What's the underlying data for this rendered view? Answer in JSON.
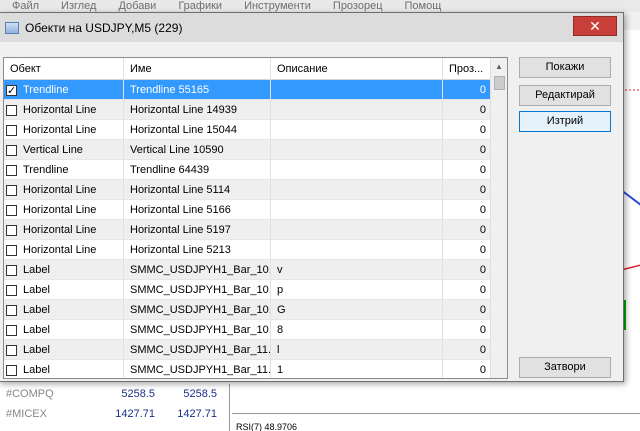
{
  "menu": [
    "Файл",
    "Изглед",
    "Добави",
    "Графики",
    "Инструменти",
    "Прозорец",
    "Помощ"
  ],
  "dialog": {
    "title": "Обекти на USDJPY,M5 (229)",
    "close_glyph": "✕",
    "columns": [
      "Обект",
      "Име",
      "Описание",
      "Проз..."
    ],
    "rows": [
      {
        "checked": true,
        "type": "Trendline",
        "name": "Trendline 55165",
        "desc": "",
        "window": "0"
      },
      {
        "checked": false,
        "type": "Horizontal Line",
        "name": "Horizontal Line 14939",
        "desc": "",
        "window": "0"
      },
      {
        "checked": false,
        "type": "Horizontal Line",
        "name": "Horizontal Line 15044",
        "desc": "",
        "window": "0"
      },
      {
        "checked": false,
        "type": "Vertical Line",
        "name": "Vertical Line 10590",
        "desc": "",
        "window": "0"
      },
      {
        "checked": false,
        "type": "Trendline",
        "name": "Trendline 64439",
        "desc": "",
        "window": "0"
      },
      {
        "checked": false,
        "type": "Horizontal Line",
        "name": "Horizontal Line 5114",
        "desc": "",
        "window": "0"
      },
      {
        "checked": false,
        "type": "Horizontal Line",
        "name": "Horizontal Line 5166",
        "desc": "",
        "window": "0"
      },
      {
        "checked": false,
        "type": "Horizontal Line",
        "name": "Horizontal Line 5197",
        "desc": "",
        "window": "0"
      },
      {
        "checked": false,
        "type": "Horizontal Line",
        "name": "Horizontal Line 5213",
        "desc": "",
        "window": "0"
      },
      {
        "checked": false,
        "type": "Label",
        "name": "SMMC_USDJPYH1_Bar_10...",
        "desc": "v",
        "window": "0"
      },
      {
        "checked": false,
        "type": "Label",
        "name": "SMMC_USDJPYH1_Bar_10...",
        "desc": "p",
        "window": "0"
      },
      {
        "checked": false,
        "type": "Label",
        "name": "SMMC_USDJPYH1_Bar_10...",
        "desc": "G",
        "window": "0"
      },
      {
        "checked": false,
        "type": "Label",
        "name": "SMMC_USDJPYH1_Bar_10...",
        "desc": "8",
        "window": "0"
      },
      {
        "checked": false,
        "type": "Label",
        "name": "SMMC_USDJPYH1_Bar_11...",
        "desc": "l",
        "window": "0"
      },
      {
        "checked": false,
        "type": "Label",
        "name": "SMMC_USDJPYH1_Bar_11...",
        "desc": "1",
        "window": "0"
      }
    ],
    "buttons": {
      "show": "Покажи",
      "edit": "Редактирай",
      "delete": "Изтрий",
      "close": "Затвори"
    }
  },
  "watch": [
    {
      "symbol": "#COMPQ",
      "bid": "5258.5",
      "ask": "5258.5"
    },
    {
      "symbol": "#MICEX",
      "bid": "1427.71",
      "ask": "1427.71"
    }
  ],
  "indicator": "RSI(7) 48.9706",
  "colors": {
    "selection": "#3399ff",
    "close_button": "#c9403a",
    "quote_text": "#1a2f8a"
  }
}
